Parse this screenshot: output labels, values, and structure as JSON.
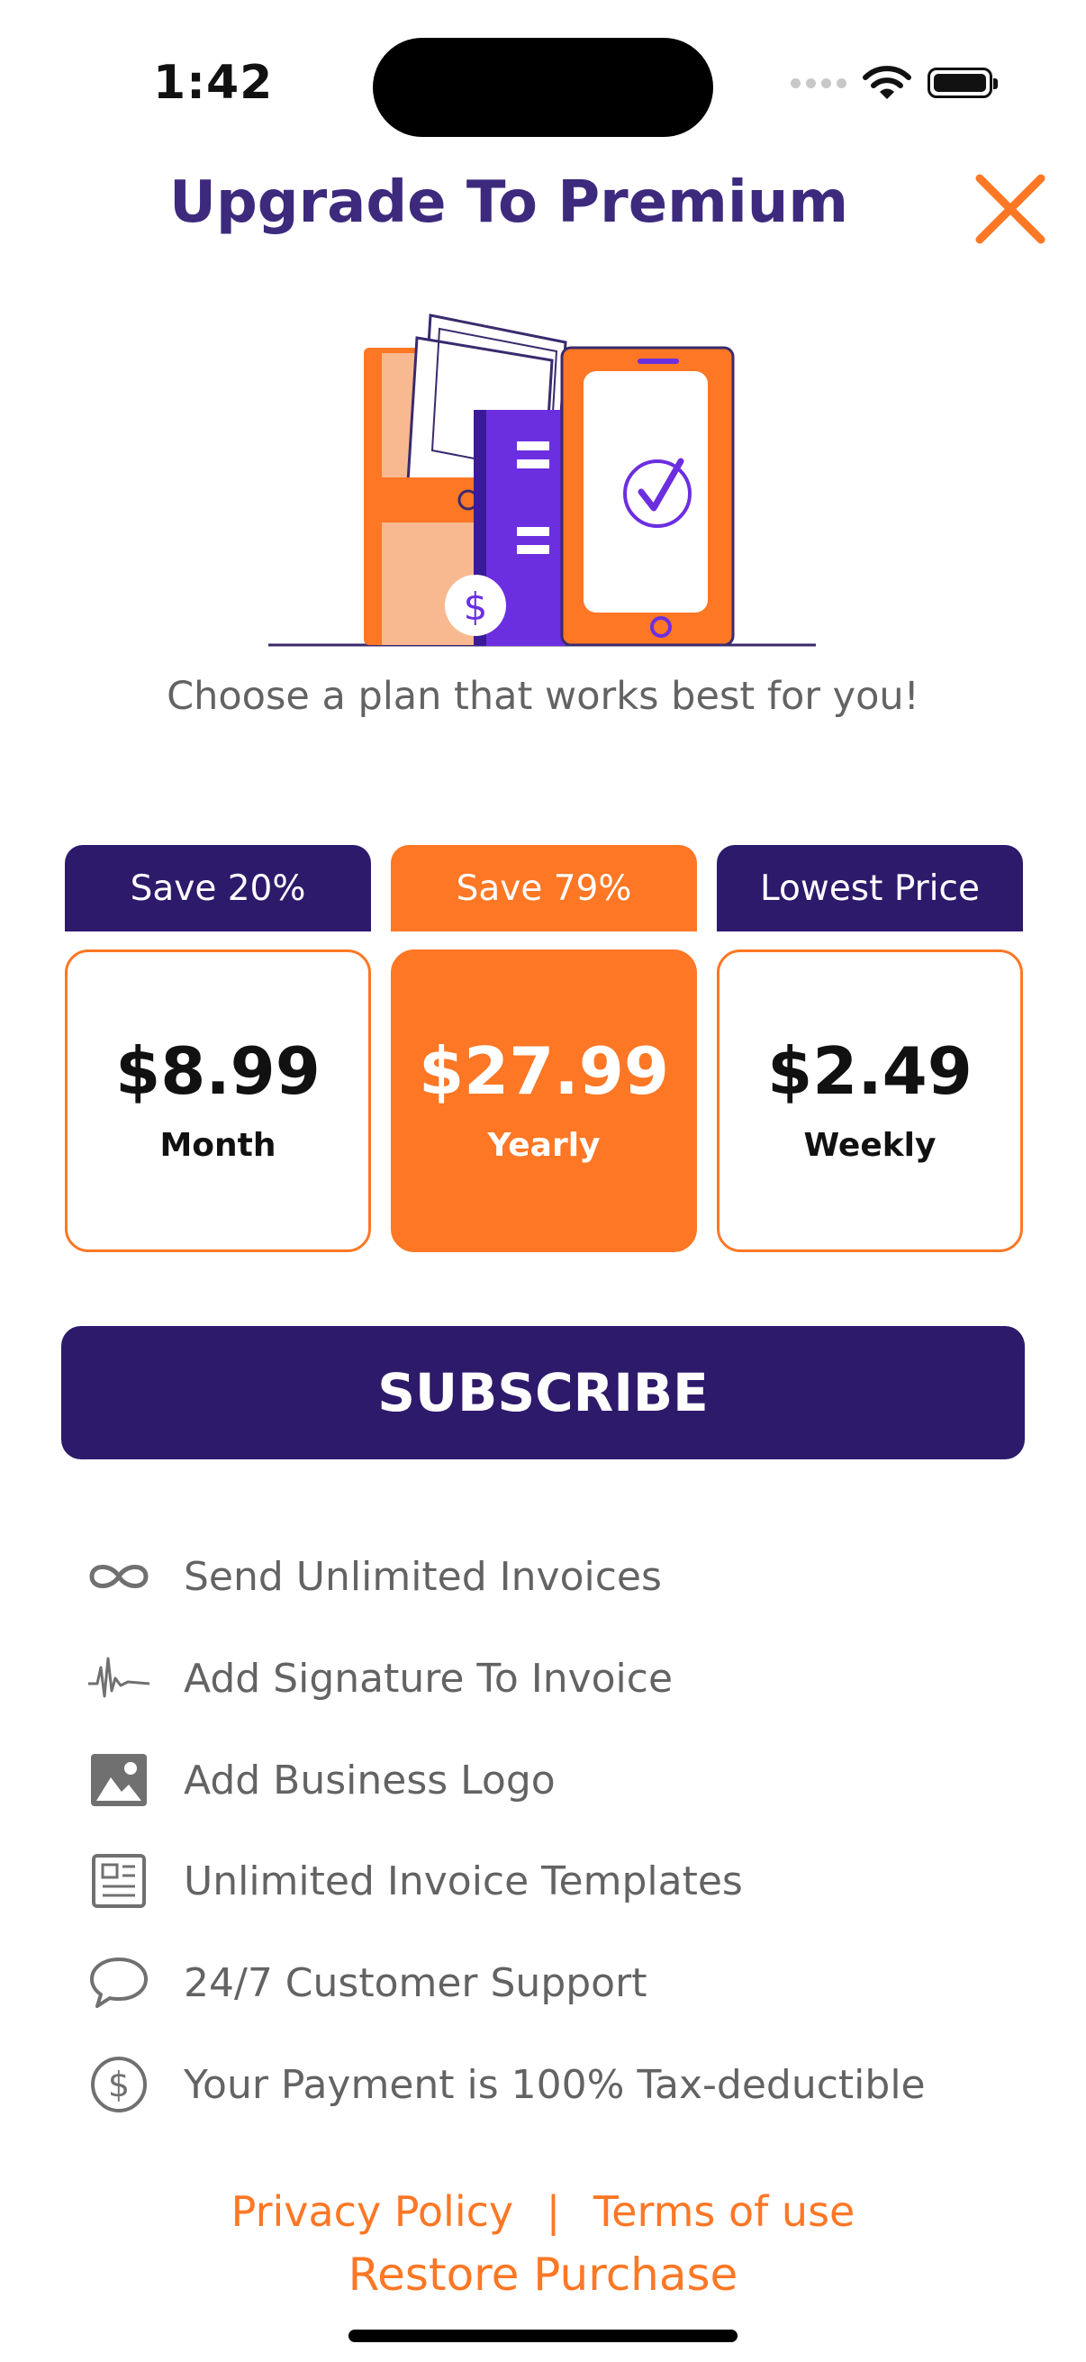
{
  "status_bar": {
    "time": "1:42",
    "icons": [
      "cellular-dots-icon",
      "wifi-icon",
      "battery-icon"
    ]
  },
  "header": {
    "title": "Upgrade To Premium",
    "close_icon": "close-icon"
  },
  "illustration": {
    "icon": "wallet-phone-payment-illustration"
  },
  "subtitle": "Choose a plan that works best for you!",
  "plans": [
    {
      "badge": "Save 20%",
      "price": "$8.99",
      "period": "Month",
      "selected": false
    },
    {
      "badge": "Save 79%",
      "price": "$27.99",
      "period": "Yearly",
      "selected": true
    },
    {
      "badge": "Lowest Price",
      "price": "$2.49",
      "period": "Weekly",
      "selected": false
    }
  ],
  "subscribe_label": "SUBSCRIBE",
  "features": [
    {
      "icon": "infinity-icon",
      "label": "Send Unlimited Invoices"
    },
    {
      "icon": "signature-icon",
      "label": "Add Signature To Invoice"
    },
    {
      "icon": "image-icon",
      "label": "Add Business Logo"
    },
    {
      "icon": "template-icon",
      "label": "Unlimited Invoice Templates"
    },
    {
      "icon": "chat-bubble-icon",
      "label": "24/7 Customer Support"
    },
    {
      "icon": "dollar-circle-icon",
      "label": "Your Payment is 100% Tax-deductible"
    }
  ],
  "footer": {
    "privacy": "Privacy Policy",
    "separator": "|",
    "terms": "Terms of use",
    "restore": "Restore Purchase"
  },
  "colors": {
    "primary": "#2e1a6b",
    "title": "#3d2a7d",
    "accent": "#fd7725",
    "muted_text": "#636363"
  }
}
